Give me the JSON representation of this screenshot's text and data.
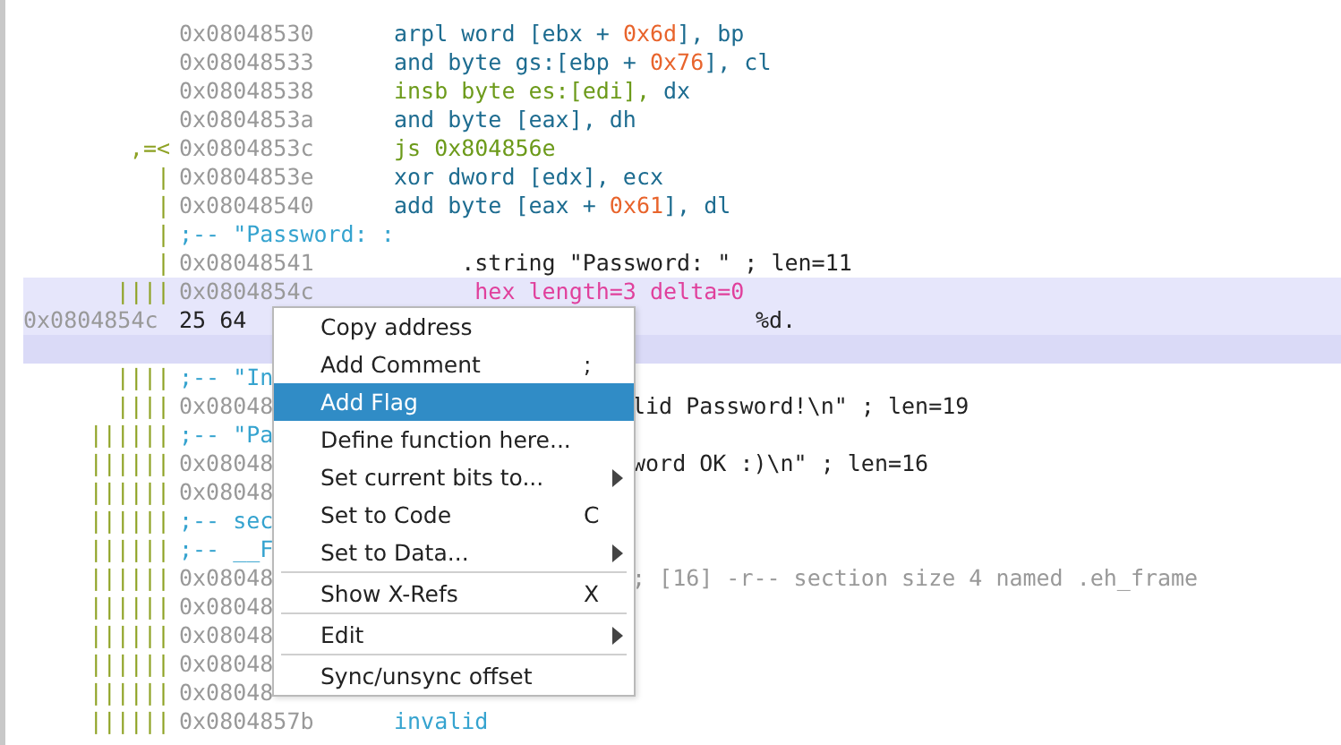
{
  "listing": {
    "rows": [
      {
        "kind": "code",
        "highlighted": false,
        "graph": "",
        "address": "0x08048530",
        "code": [
          {
            "text": "arpl word [ebx + ",
            "kind": "op"
          },
          {
            "text": "0x6d",
            "kind": "num"
          },
          {
            "text": "], bp",
            "kind": "op"
          }
        ]
      },
      {
        "kind": "code",
        "highlighted": false,
        "graph": "",
        "address": "0x08048533",
        "code": [
          {
            "text": "and byte gs:[ebp + ",
            "kind": "op"
          },
          {
            "text": "0x76",
            "kind": "num"
          },
          {
            "text": "], cl",
            "kind": "op"
          }
        ]
      },
      {
        "kind": "code",
        "highlighted": false,
        "graph": "",
        "address": "0x08048538",
        "code": [
          {
            "text": "insb byte es:[edi], ",
            "kind": "flow"
          },
          {
            "text": "dx",
            "kind": "op"
          }
        ]
      },
      {
        "kind": "code",
        "highlighted": false,
        "graph": "",
        "address": "0x0804853a",
        "code": [
          {
            "text": "and byte [eax], dh",
            "kind": "op"
          }
        ]
      },
      {
        "kind": "code",
        "highlighted": false,
        "graph": ",=<",
        "address": "0x0804853c",
        "code": [
          {
            "text": "js 0x804856e",
            "kind": "flow"
          }
        ]
      },
      {
        "kind": "code",
        "highlighted": false,
        "graph": "|",
        "address": "0x0804853e",
        "code": [
          {
            "text": "xor dword [edx], ecx",
            "kind": "op"
          }
        ]
      },
      {
        "kind": "code",
        "highlighted": false,
        "graph": "|",
        "address": "0x08048540",
        "code": [
          {
            "text": "add byte [eax + ",
            "kind": "op"
          },
          {
            "text": "0x61",
            "kind": "num"
          },
          {
            "text": "], dl",
            "kind": "op"
          }
        ]
      },
      {
        "kind": "code",
        "highlighted": false,
        "graph": "|",
        "address": ";-- \"Password: :",
        "code": []
      },
      {
        "kind": "code",
        "highlighted": false,
        "graph": "|",
        "address": "0x08048541",
        "code": [
          {
            "text": "     .string \"Password: \" ; len=11",
            "kind": "plain"
          }
        ]
      },
      {
        "kind": "code",
        "highlighted": true,
        "graph": "||||",
        "address": "0x0804854c",
        "code": [
          {
            "text": "      hex length=3 delta=0",
            "kind": "meta"
          }
        ]
      },
      {
        "kind": "hex",
        "highlighted": true,
        "offset": "0x0804854c",
        "bytes": "25 64",
        "ascii": "%d."
      },
      {
        "kind": "blank",
        "highlighted": true
      },
      {
        "kind": "code",
        "highlighted": false,
        "graph": "||||",
        "address": ";-- \"In",
        "code": []
      },
      {
        "kind": "code",
        "highlighted": false,
        "graph": "||||",
        "address": "0x08048",
        "code": [],
        "tail": "lid Password!\\n\" ; len=19"
      },
      {
        "kind": "code",
        "highlighted": false,
        "graph": "||||||",
        "address": ";-- \"Pa",
        "code": []
      },
      {
        "kind": "code",
        "highlighted": false,
        "graph": "||||||",
        "address": "0x08048",
        "code": [],
        "tail": "word OK :)\\n\" ; len=16"
      },
      {
        "kind": "code",
        "highlighted": false,
        "graph": "||||||",
        "address": "0x08048",
        "code": []
      },
      {
        "kind": "code",
        "highlighted": false,
        "graph": "||||||",
        "address": ";-- sec",
        "code": []
      },
      {
        "kind": "code",
        "highlighted": false,
        "graph": "||||||",
        "address": ";-- __F",
        "code": []
      },
      {
        "kind": "code",
        "highlighted": false,
        "graph": "||||||",
        "address": "0x08048",
        "code": [],
        "tail": "; [16] -r-- section size 4 named .eh_frame"
      },
      {
        "kind": "code",
        "highlighted": false,
        "graph": "||||||",
        "address": "0x08048",
        "code": []
      },
      {
        "kind": "code",
        "highlighted": false,
        "graph": "||||||",
        "address": "0x08048",
        "code": []
      },
      {
        "kind": "code",
        "highlighted": false,
        "graph": "||||||",
        "address": "0x08048",
        "code": []
      },
      {
        "kind": "code",
        "highlighted": false,
        "graph": "||||||",
        "address": "0x08048",
        "code": []
      },
      {
        "kind": "code",
        "highlighted": false,
        "graph": "||||||",
        "address": "0x0804857b",
        "code": [
          {
            "text": "invalid",
            "kind": "comment"
          }
        ]
      }
    ]
  },
  "context_menu": {
    "items": [
      {
        "kind": "item",
        "label": "Copy address",
        "selected": false,
        "submenu": false
      },
      {
        "kind": "item",
        "label": "Add Comment",
        "shortcut": ";",
        "selected": false,
        "submenu": false
      },
      {
        "kind": "item",
        "label": "Add Flag",
        "selected": true,
        "submenu": false
      },
      {
        "kind": "item",
        "label": "Define function here...",
        "selected": false,
        "submenu": false
      },
      {
        "kind": "item",
        "label": "Set current bits to...",
        "selected": false,
        "submenu": true
      },
      {
        "kind": "item",
        "label": "Set to Code",
        "shortcut": "C",
        "selected": false,
        "submenu": false
      },
      {
        "kind": "item",
        "label": "Set to Data...",
        "selected": false,
        "submenu": true
      },
      {
        "kind": "separator"
      },
      {
        "kind": "item",
        "label": "Show X-Refs",
        "shortcut": "X",
        "selected": false,
        "submenu": false
      },
      {
        "kind": "separator"
      },
      {
        "kind": "item",
        "label": "Edit",
        "selected": false,
        "submenu": true
      },
      {
        "kind": "separator"
      },
      {
        "kind": "item",
        "label": "Sync/unsync offset",
        "selected": false,
        "submenu": false
      }
    ]
  }
}
